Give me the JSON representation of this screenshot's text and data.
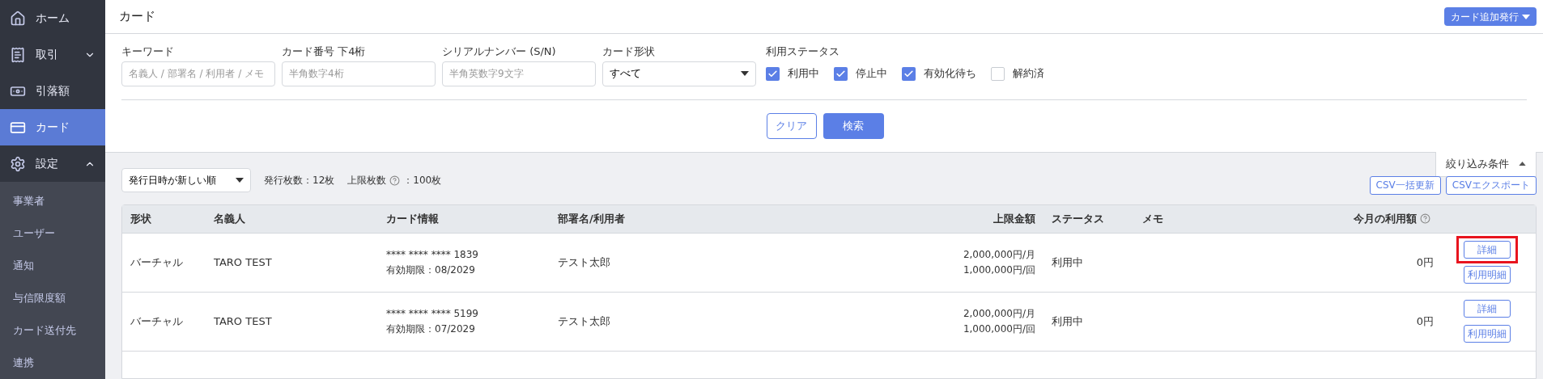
{
  "sidebar": {
    "items": [
      {
        "label": "ホーム",
        "selected": false
      },
      {
        "label": "取引",
        "selected": false,
        "expanded": false
      },
      {
        "label": "引落額",
        "selected": false
      },
      {
        "label": "カード",
        "selected": true
      },
      {
        "label": "設定",
        "selected": false,
        "expanded": true,
        "children": [
          {
            "label": "事業者"
          },
          {
            "label": "ユーザー"
          },
          {
            "label": "通知"
          },
          {
            "label": "与信限度額"
          },
          {
            "label": "カード送付先"
          },
          {
            "label": "連携"
          }
        ]
      }
    ]
  },
  "header": {
    "title": "カード",
    "action_button": "カード追加発行"
  },
  "filters": {
    "fields": [
      {
        "label": "キーワード",
        "placeholder": "名義人 / 部署名 / 利用者 / メモ"
      },
      {
        "label": "カード番号 下4桁",
        "placeholder": "半角数字4桁"
      },
      {
        "label": "シリアルナンバー (S/N)",
        "placeholder": "半角英数字9文字"
      }
    ],
    "card_type": {
      "label": "カード形状",
      "value": "すべて"
    },
    "status": {
      "label": "利用ステータス",
      "options": [
        {
          "label": "利用中",
          "checked": true
        },
        {
          "label": "停止中",
          "checked": true
        },
        {
          "label": "有効化待ち",
          "checked": true
        },
        {
          "label": "解約済",
          "checked": false
        }
      ]
    },
    "buttons": [
      "クリア",
      "検索"
    ],
    "toggle": "絞り込み条件"
  },
  "toolbar": {
    "sort": "発行日時が新しい順",
    "issued": "発行枚数：12枚",
    "limit_label": "上限枚数",
    "limit_value": "：100枚",
    "buttons": [
      "CSV一括更新",
      "CSVエクスポート"
    ]
  },
  "table": {
    "columns": [
      "形状",
      "名義人",
      "カード情報",
      "部署名/利用者",
      "上限金額",
      "ステータス",
      "メモ",
      "今月の利用額"
    ],
    "rows": [
      {
        "type": "バーチャル",
        "holder": "TARO TEST",
        "number": "**** **** **** 1839",
        "expiry": "有効期限：08/2029",
        "user": "テスト太郎",
        "limit_month": "2,000,000円/月",
        "limit_once": "1,000,000円/回",
        "status": "利用中",
        "usage": "0円",
        "buttons": [
          "詳細",
          "利用明細"
        ],
        "highlighted": true
      },
      {
        "type": "バーチャル",
        "holder": "TARO TEST",
        "number": "**** **** **** 5199",
        "expiry": "有効期限：07/2029",
        "user": "テスト太郎",
        "limit_month": "2,000,000円/月",
        "limit_once": "1,000,000円/回",
        "status": "利用中",
        "usage": "0円",
        "buttons": [
          "詳細",
          "利用明細"
        ],
        "highlighted": false
      }
    ]
  }
}
